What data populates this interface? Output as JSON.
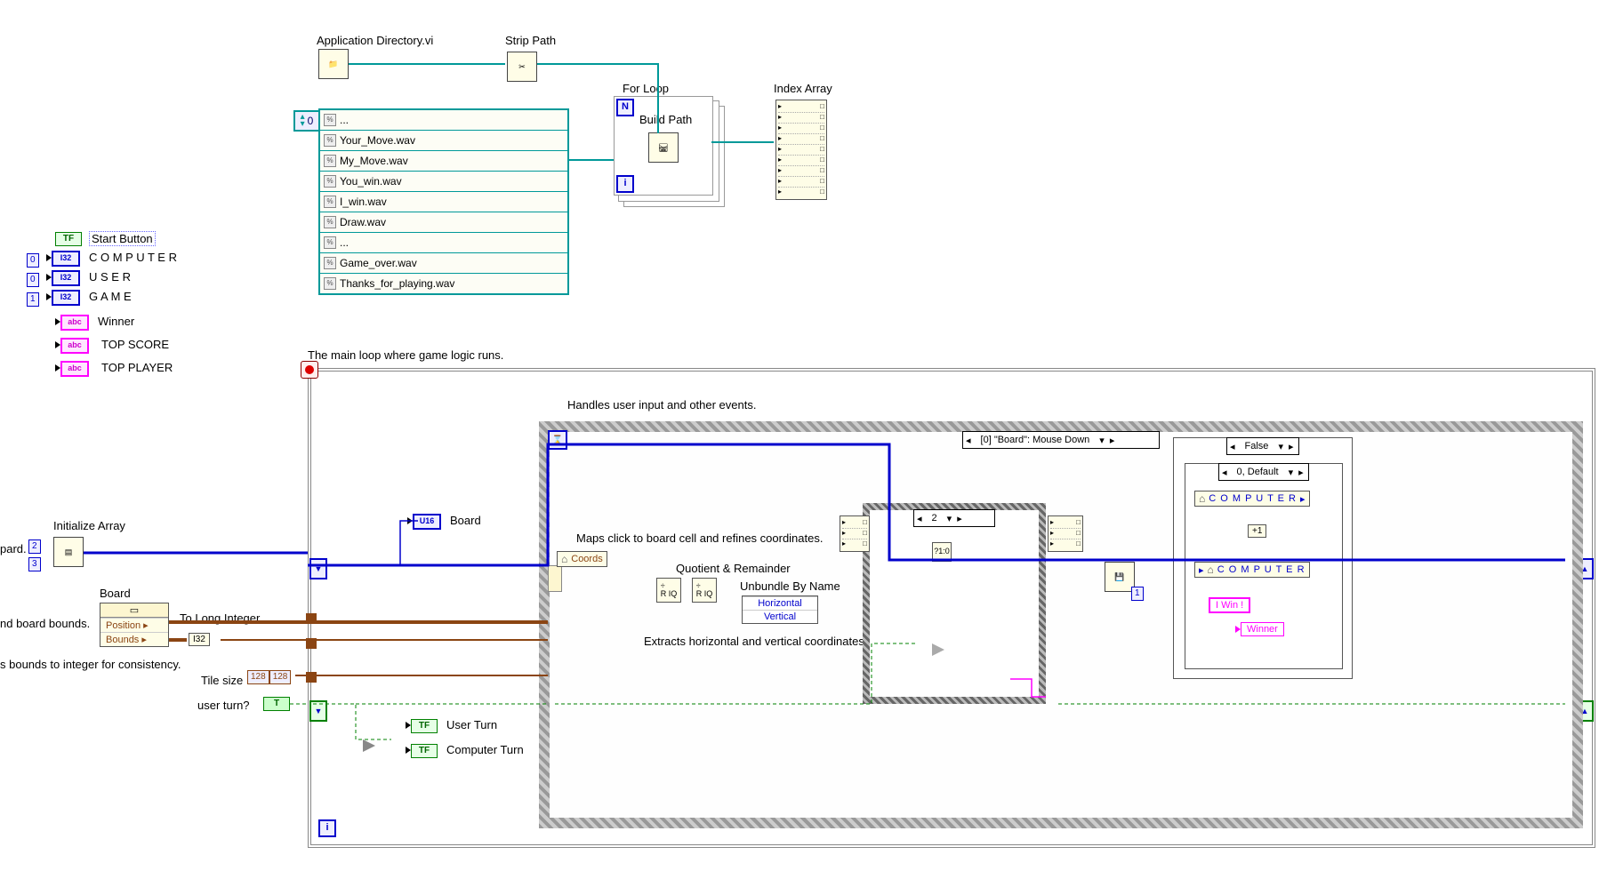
{
  "top_nodes": {
    "app_dir_label": "Application Directory.vi",
    "strip_path_label": "Strip Path",
    "for_loop_label": "For Loop",
    "build_path_label": "Build Path",
    "index_array_label": "Index Array"
  },
  "array_constant": {
    "index": "0",
    "rows": [
      "...",
      "Your_Move.wav",
      "My_Move.wav",
      "You_win.wav",
      "I_win.wav",
      "Draw.wav",
      "...",
      "Game_over.wav",
      "Thanks_for_playing.wav"
    ]
  },
  "left_terminals": {
    "start_button": "Start Button",
    "computer": "C  O  M  P  U  T  E  R",
    "user": "U  S  E  R",
    "game": "G  A  M  E",
    "computer_init": "0",
    "user_init": "0",
    "game_init": "1",
    "winner": "Winner",
    "top_score": "TOP SCORE",
    "top_player": "TOP PLAYER"
  },
  "comments": {
    "main_loop": "The main loop where game logic runs.",
    "handles_events": "Handles user input and other events.",
    "map_click": "Maps click to board cell and refines coordinates.",
    "extract_hv": "Extracts horizontal and vertical coordinates.",
    "board_bounds_partial": "nd board bounds.",
    "bounds_int_partial": "s bounds to integer for consistency.",
    "pard_partial": "pard."
  },
  "init_array": {
    "label": "Initialize Array",
    "dim1": "2",
    "dim2": "3"
  },
  "board_propnode": {
    "label": "Board",
    "position": "Position",
    "bounds": "Bounds",
    "to_long_int": "To Long Integer",
    "i32": "I32"
  },
  "tile_size": {
    "label": "Tile size",
    "v1": "128",
    "v2": "128"
  },
  "user_turn_const": {
    "label": "user turn?",
    "value": "T"
  },
  "indicators": {
    "user_turn": "User Turn",
    "computer_turn": "Computer Turn"
  },
  "event": {
    "case": "[0] \"Board\": Mouse Down",
    "board_local": "Board",
    "coords_local": "Coords",
    "qr_label": "Quotient & Remainder",
    "unbundle_label": "Unbundle By Name",
    "unbundle_rows": [
      "Horizontal",
      "Vertical"
    ],
    "inner_seq_sel": "2",
    "inner_sel_node": "?1:0"
  },
  "right_case": {
    "outer_sel": "False",
    "inner_sel": "0, Default",
    "computer_read": "C  O  M  P  U  T  E  R",
    "computer_write": "C  O  M  P  U  T  E  R",
    "inc": "+1",
    "iwin": "I Win !",
    "winner_ind": "Winner"
  }
}
